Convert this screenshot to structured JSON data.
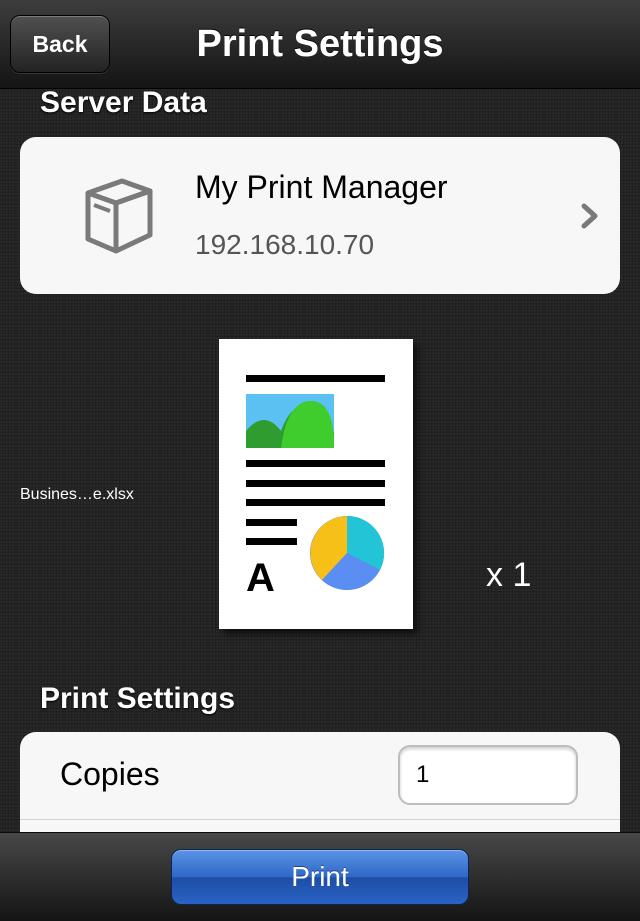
{
  "navbar": {
    "back_label": "Back",
    "title": "Print Settings"
  },
  "server_section": {
    "header": "Server Data",
    "server": {
      "name": "My Print Manager",
      "ip": "192.168.10.70",
      "icon": "printer-box-icon",
      "chevron": "chevron-right-icon"
    }
  },
  "document": {
    "filename": "Busines…e.xlsx",
    "copies_indicator": "x 1",
    "preview_letter": "A"
  },
  "print_settings": {
    "header": "Print Settings",
    "copies_label": "Copies",
    "copies_value": "1"
  },
  "toolbar": {
    "print_label": "Print"
  },
  "colors": {
    "print_button": "#2f67c7",
    "card_bg": "#f7f7f7",
    "background": "#262626"
  }
}
